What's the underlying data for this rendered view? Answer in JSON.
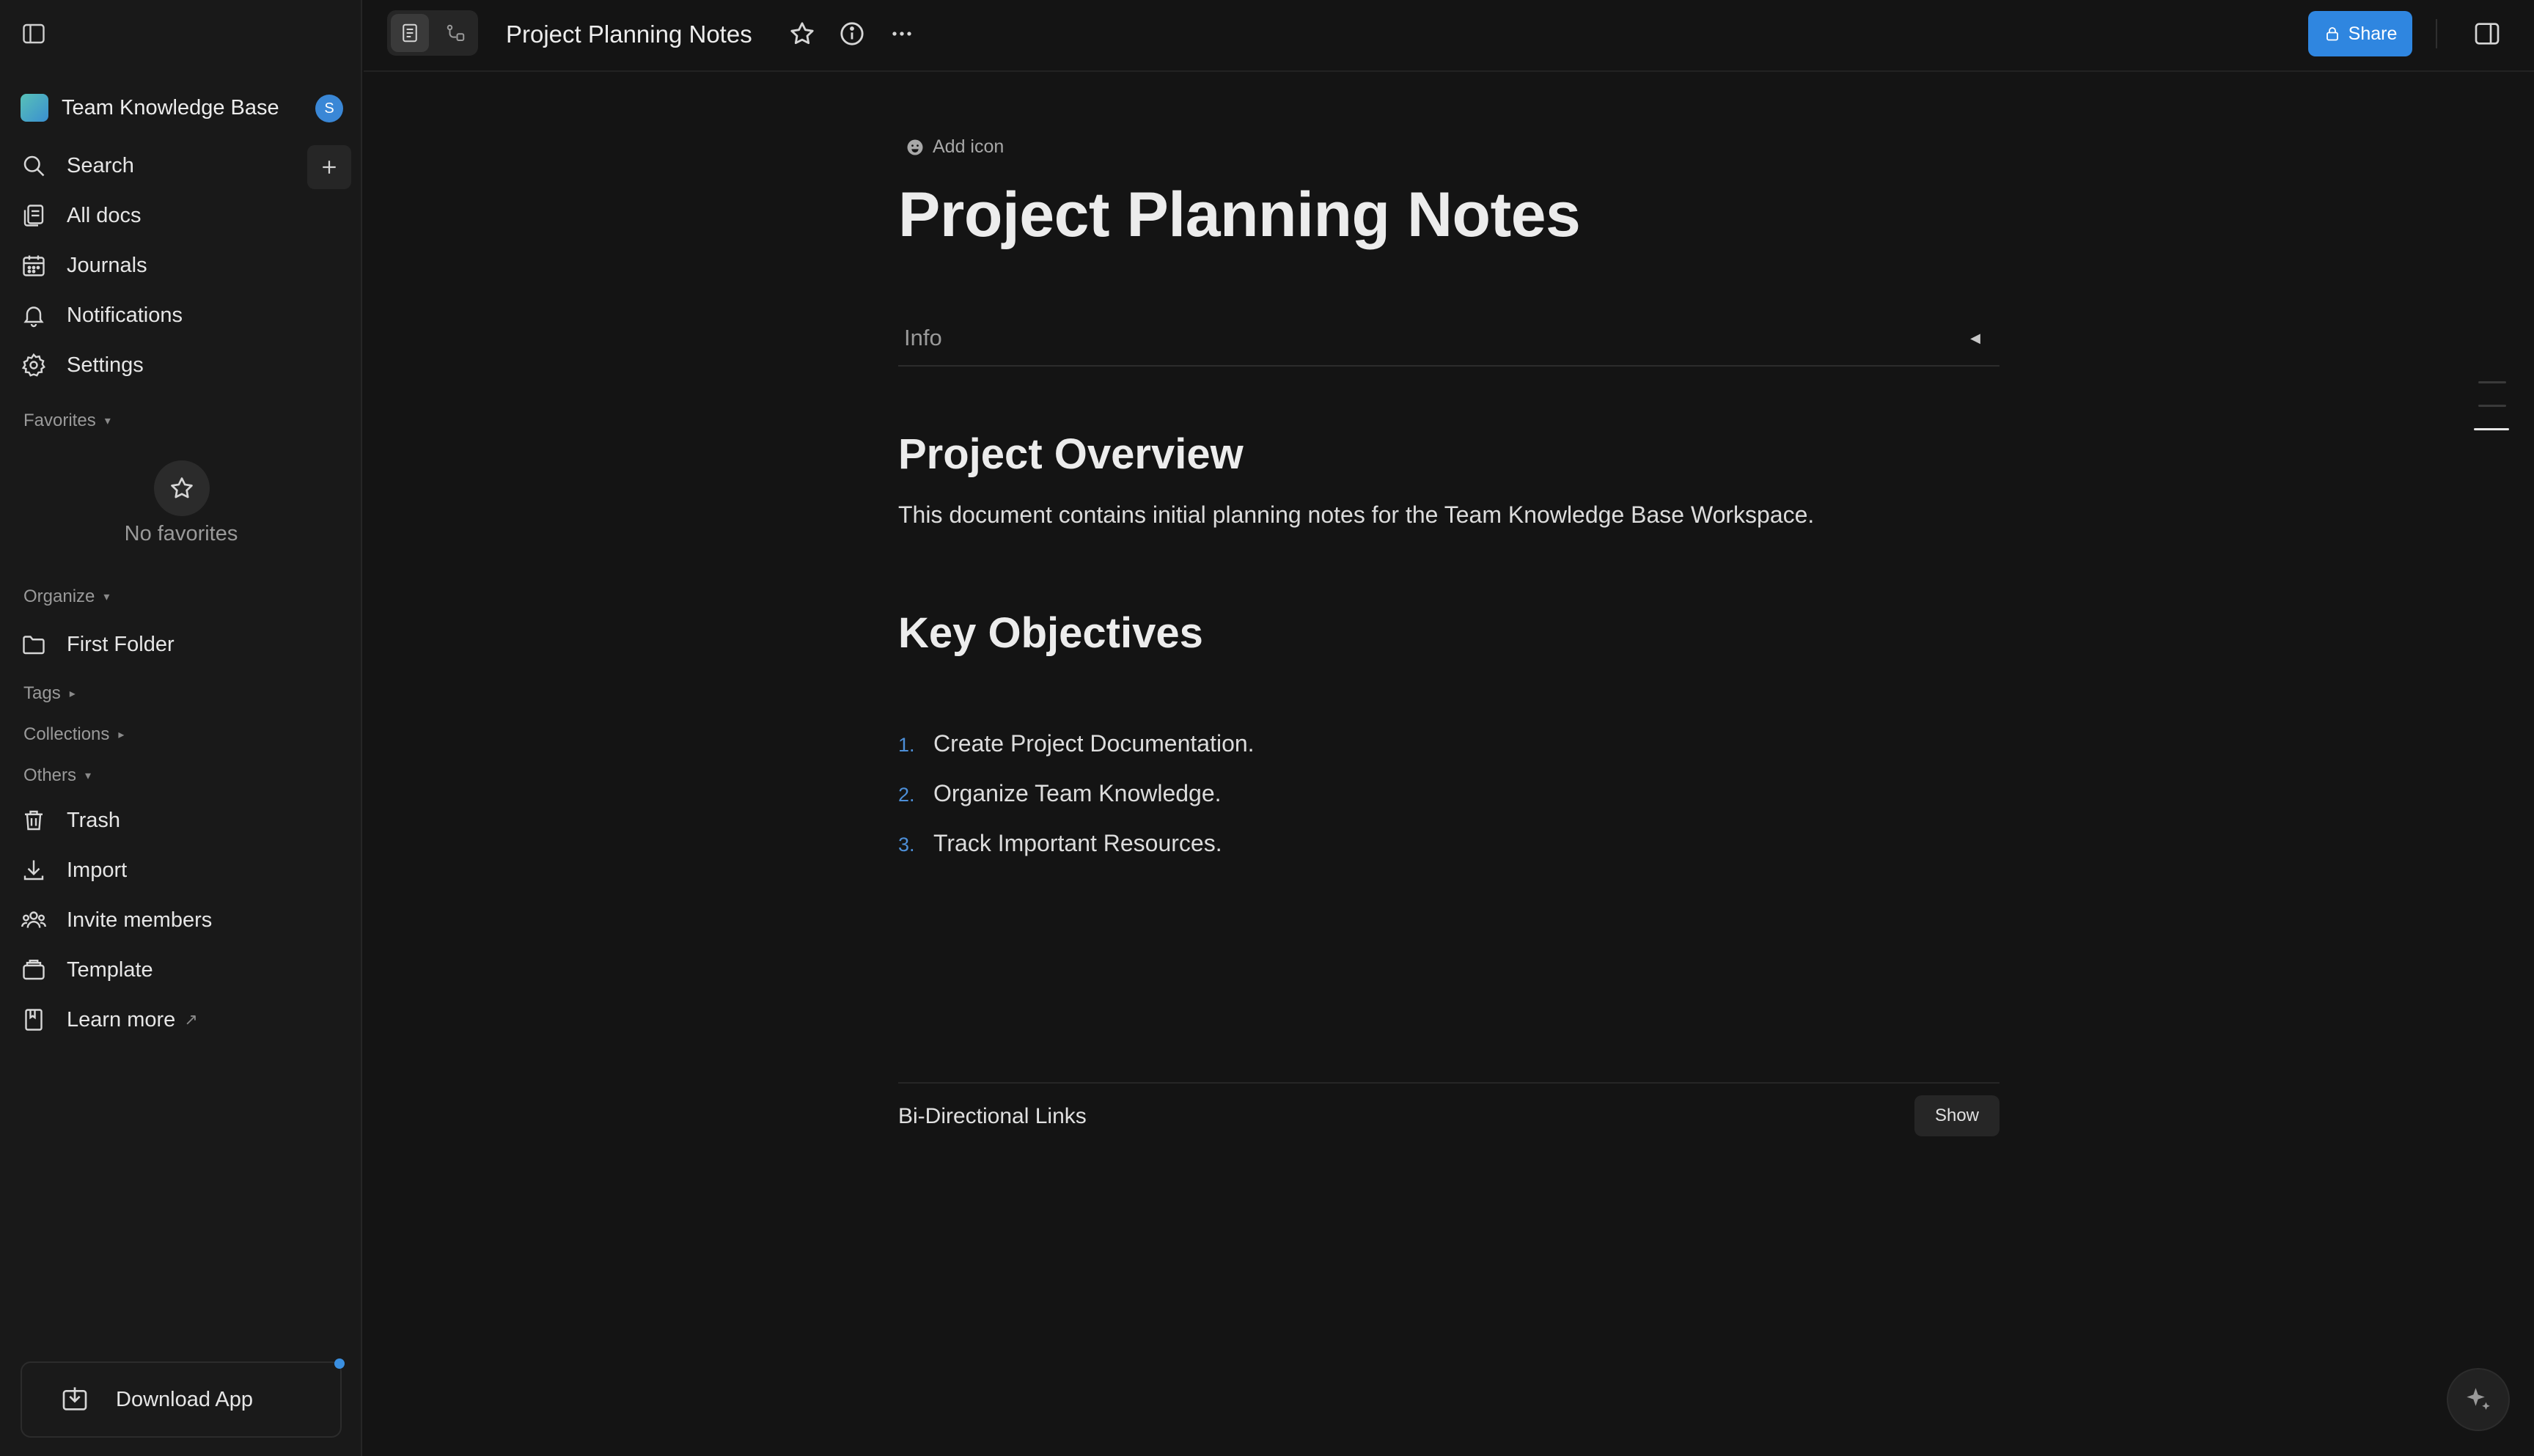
{
  "sidebar": {
    "workspace": {
      "name": "Team Knowledge Base",
      "avatar_letter": "S"
    },
    "nav": [
      {
        "label": "Search",
        "icon": "search-icon"
      },
      {
        "label": "All docs",
        "icon": "all-docs-icon"
      },
      {
        "label": "Journals",
        "icon": "calendar-icon"
      },
      {
        "label": "Notifications",
        "icon": "bell-icon"
      },
      {
        "label": "Settings",
        "icon": "gear-icon"
      }
    ],
    "favorites": {
      "title": "Favorites",
      "empty_text": "No favorites"
    },
    "organize": {
      "title": "Organize",
      "items": [
        {
          "label": "First Folder",
          "icon": "folder-icon"
        }
      ]
    },
    "tags": {
      "title": "Tags"
    },
    "collections": {
      "title": "Collections"
    },
    "others": {
      "title": "Others",
      "items": [
        {
          "label": "Trash",
          "icon": "trash-icon"
        },
        {
          "label": "Import",
          "icon": "import-icon"
        },
        {
          "label": "Invite members",
          "icon": "members-icon"
        },
        {
          "label": "Template",
          "icon": "template-icon"
        },
        {
          "label": "Learn more",
          "icon": "book-icon",
          "external_mark": "↗"
        }
      ]
    },
    "download_label": "Download App"
  },
  "topbar": {
    "doc_title": "Project Planning Notes",
    "share_label": "Share"
  },
  "document": {
    "add_icon_label": "Add icon",
    "title": "Project Planning Notes",
    "info_label": "Info",
    "sections": [
      {
        "heading": "Project Overview",
        "paragraph": "This document contains initial planning notes for the Team Knowledge Base Workspace."
      },
      {
        "heading": "Key Objectives",
        "list": [
          {
            "num": "1.",
            "text": "Create Project Documentation."
          },
          {
            "num": "2.",
            "text": "Organize Team Knowledge."
          },
          {
            "num": "3.",
            "text": "Track Important Resources."
          }
        ]
      }
    ],
    "bidirectional": {
      "label": "Bi-Directional Links",
      "button": "Show"
    }
  },
  "colors": {
    "background": "#141414",
    "sidebar": "#191919",
    "accent": "#2f86e0",
    "list_number": "#4d8fd8"
  }
}
